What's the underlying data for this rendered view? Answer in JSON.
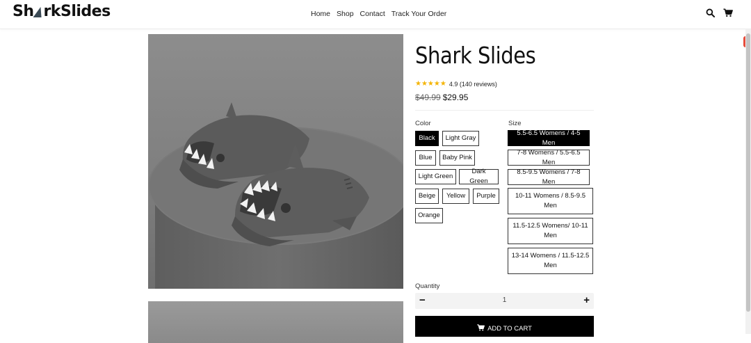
{
  "header": {
    "logo_prefix": "Sh",
    "logo_suffix": "rkSlides",
    "nav": [
      "Home",
      "Shop",
      "Contact",
      "Track Your Order"
    ]
  },
  "product": {
    "title": "Shark Slides",
    "stars": "★★★★★",
    "rating_text": "4.9 (140 reviews)",
    "price_old": "$49.99",
    "price_new": "$29.95"
  },
  "options": {
    "color_label": "Color",
    "colors": [
      "Black",
      "Light Gray",
      "Blue",
      "Baby Pink",
      "Light Green",
      "Dark Green",
      "Beige",
      "Yellow",
      "Purple",
      "Orange"
    ],
    "selected_color": "Black",
    "size_label": "Size",
    "sizes": [
      "5.5-6.5 Womens / 4-5 Men",
      "7-8 Womens / 5.5-6.5 Men",
      "8.5-9.5 Womens / 7-8 Men",
      "10-11 Womens / 8.5-9.5 Men",
      "11.5-12.5 Womens/ 10-11 Men",
      "13-14 Womens / 11.5-12.5 Men"
    ],
    "selected_size": "5.5-6.5 Womens / 4-5 Men"
  },
  "quantity": {
    "label": "Quantity",
    "value": "1",
    "minus": "−",
    "plus": "+"
  },
  "cart": {
    "label": "ADD TO CART"
  },
  "colors": {
    "accent": "#000000",
    "stars": "#f4b400",
    "slide": "#5a5a5a"
  }
}
